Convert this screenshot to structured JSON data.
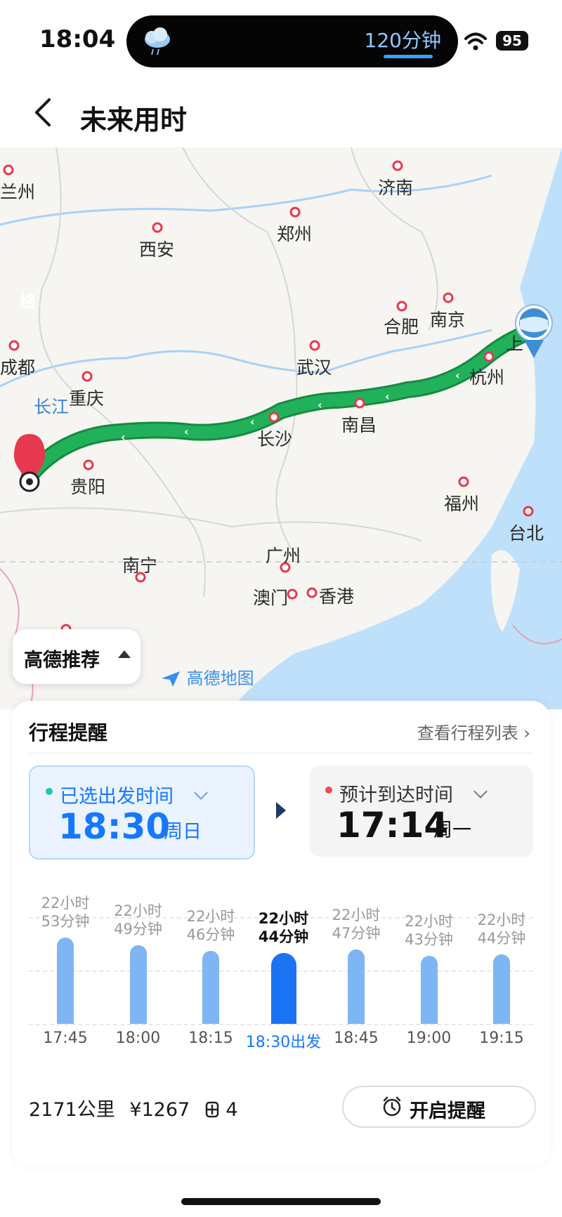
{
  "status_bar": {
    "time": "18:04",
    "island_text": "120分钟",
    "battery": "95"
  },
  "header": {
    "title": "未来用时"
  },
  "map": {
    "cities": [
      "济南",
      "兰州",
      "西安",
      "郑州",
      "合肥",
      "南京",
      "成都",
      "武汉",
      "杭州",
      "上",
      "重庆",
      "长沙",
      "南昌",
      "贵阳",
      "福州",
      "台北",
      "南宁",
      "广州",
      "澳门",
      "香港"
    ],
    "river_label": "长江",
    "end_marker": "终",
    "recommend_label": "高德推荐",
    "logo_text": "高德地图"
  },
  "card": {
    "title": "行程提醒",
    "link": "查看行程列表 ›",
    "departure": {
      "label": "已选出发时间",
      "time": "18:30",
      "weekday": "周日"
    },
    "arrival": {
      "label": "预计到达时间",
      "time": "17:14",
      "weekday": "周一"
    },
    "columns": [
      {
        "line1": "22小时",
        "line2": "53分钟",
        "x_label": "17:45"
      },
      {
        "line1": "22小时",
        "line2": "49分钟",
        "x_label": "18:00"
      },
      {
        "line1": "22小时",
        "line2": "46分钟",
        "x_label": "18:15"
      },
      {
        "line1": "22小时",
        "line2": "44分钟",
        "x_label": "18:30出发",
        "selected": true
      },
      {
        "line1": "22小时",
        "line2": "47分钟",
        "x_label": "18:45"
      },
      {
        "line1": "22小时",
        "line2": "43分钟",
        "x_label": "19:00"
      },
      {
        "line1": "22小时",
        "line2": "44分钟",
        "x_label": "19:15"
      }
    ],
    "bar_level": [
      0.88,
      0.8,
      0.74,
      0.72,
      0.76,
      0.69,
      0.71
    ],
    "distance": "2171公里",
    "cost": "¥1267",
    "toll_count": "4",
    "remind_button": "开启提醒"
  },
  "colors": {
    "accent": "#1677ff",
    "route": "#21b15a",
    "selected_bar": "#1a73f2",
    "bar": "#7eb5f5",
    "marker": "#e8384f"
  }
}
